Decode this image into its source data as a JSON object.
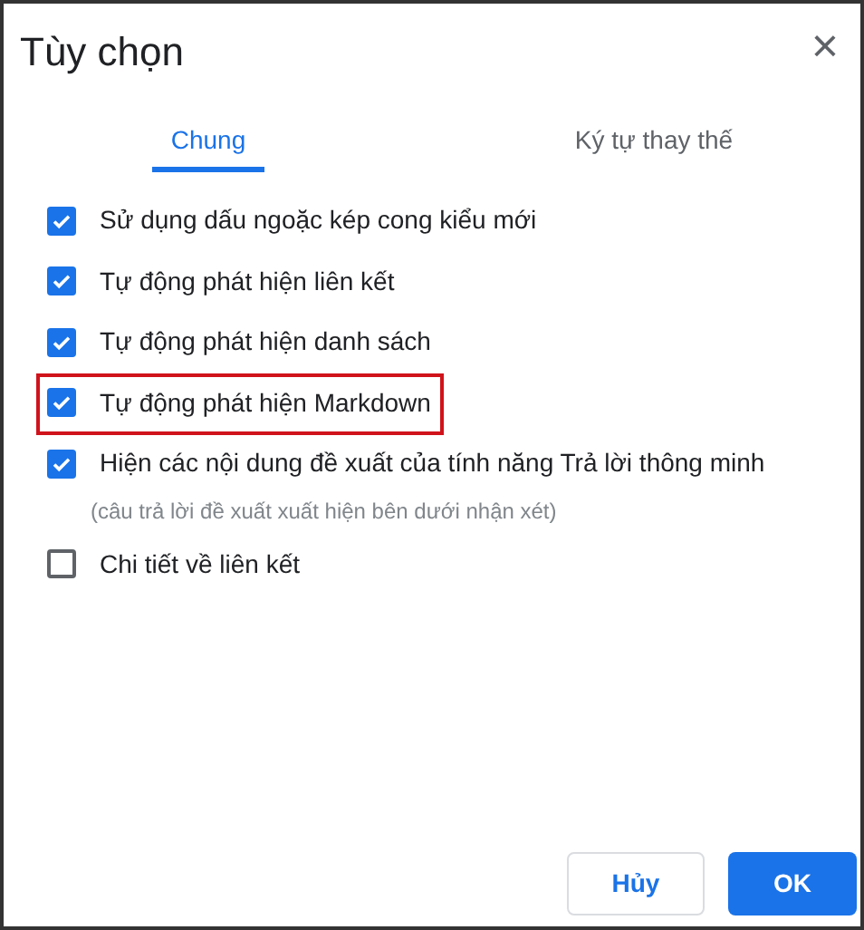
{
  "dialog": {
    "title": "Tùy chọn",
    "close_icon": "×"
  },
  "tabs": [
    {
      "label": "Chung",
      "selected": true
    },
    {
      "label": "Ký tự thay thế",
      "selected": false
    }
  ],
  "options": [
    {
      "label": "Sử dụng dấu ngoặc kép cong kiểu mới",
      "checked": true,
      "highlighted": false
    },
    {
      "label": "Tự động phát hiện liên kết",
      "checked": true,
      "highlighted": false
    },
    {
      "label": "Tự động phát hiện danh sách",
      "checked": true,
      "highlighted": false
    },
    {
      "label": "Tự động phát hiện Markdown",
      "checked": true,
      "highlighted": true
    },
    {
      "label": "Hiện các nội dung đề xuất của tính năng Trả lời thông minh",
      "checked": true,
      "highlighted": false,
      "note": "(câu trả lời đề xuất xuất hiện bên dưới nhận xét)"
    },
    {
      "label": "Chi tiết về liên kết",
      "checked": false,
      "highlighted": false
    }
  ],
  "buttons": [
    {
      "label": "Hủy",
      "kind": "secondary"
    },
    {
      "label": "OK",
      "kind": "primary"
    }
  ]
}
